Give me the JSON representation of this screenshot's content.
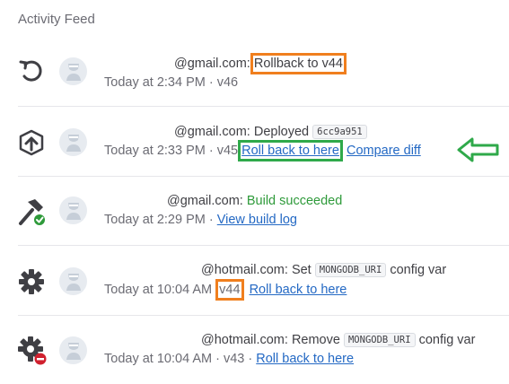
{
  "title": "Activity Feed",
  "colors": {
    "orange_highlight": "#f07f1e",
    "green_highlight": "#2fa94a",
    "link": "#2469c4",
    "success": "#2e9a3a"
  },
  "rows": [
    {
      "icon": "rollback-icon",
      "user": "@gmail.com",
      "sep": ":",
      "action": "Rollback to v44",
      "time": "Today at 2:34 PM · v46"
    },
    {
      "icon": "deploy-upload-icon",
      "user": "@gmail.com",
      "action": ": Deployed",
      "commit": "6cc9a951",
      "time": "Today at 2:33 PM · v45",
      "rollback_link": "Roll back to here",
      "compare_link": "Compare diff"
    },
    {
      "icon": "build-hammer-icon",
      "user": "@gmail.com",
      "action": ": ",
      "status": "Build succeeded",
      "time": "Today at 2:29 PM ·",
      "log_link": "View build log"
    },
    {
      "icon": "gear-icon",
      "user": "@hotmail.com",
      "action": ": Set",
      "var": "MONGODB_URI",
      "suffix": "config var",
      "time": "Today at 10:04 AM",
      "version": "v44",
      "rollback_link": "Roll back to here"
    },
    {
      "icon": "gear-remove-icon",
      "user": "@hotmail.com",
      "action": ": Remove",
      "var": "MONGODB_URI",
      "suffix": "config var",
      "time": "Today at 10:04 AM · v43 ·",
      "rollback_link": "Roll back to here"
    }
  ]
}
